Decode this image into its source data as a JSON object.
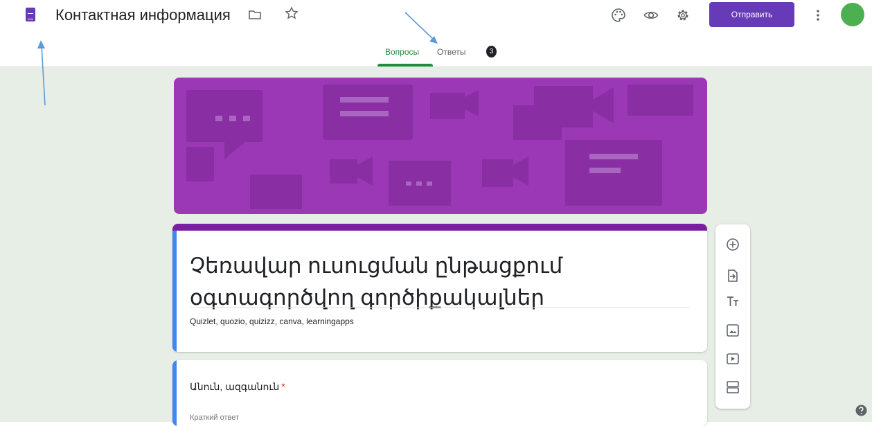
{
  "header": {
    "title": "Контактная информация",
    "send_label": "Отправить",
    "icons": [
      "forms-app-icon",
      "folder-icon",
      "star-icon",
      "palette-icon",
      "eye-icon",
      "gear-icon",
      "more-vert-icon",
      "avatar"
    ]
  },
  "tabs": [
    {
      "label": "Вопросы",
      "active": true
    },
    {
      "label": "Ответы",
      "badge": "3"
    }
  ],
  "form": {
    "title": "Չեռավար ուսուցման ընթացքում օգտագործվող գործիքակալներ",
    "description": "Quizlet, quozio, quizizz, canva,  learningapps"
  },
  "question": {
    "label": "Անուն, ազգանուն",
    "required_mark": "*",
    "placeholder": "Краткий ответ"
  },
  "toolbar": {
    "icons": [
      "add-question-icon",
      "import-questions-icon",
      "add-title-icon",
      "add-image-icon",
      "add-video-icon",
      "add-section-icon"
    ]
  },
  "colors": {
    "accent": "#673ab7",
    "banner": "#9b38b5",
    "active_tab": "#1e8e3e",
    "canvas": "#e6eee5",
    "card_strip": "#4285f4",
    "avatar": "#4caf50",
    "annotation_arrow": "#5b9bd5"
  }
}
